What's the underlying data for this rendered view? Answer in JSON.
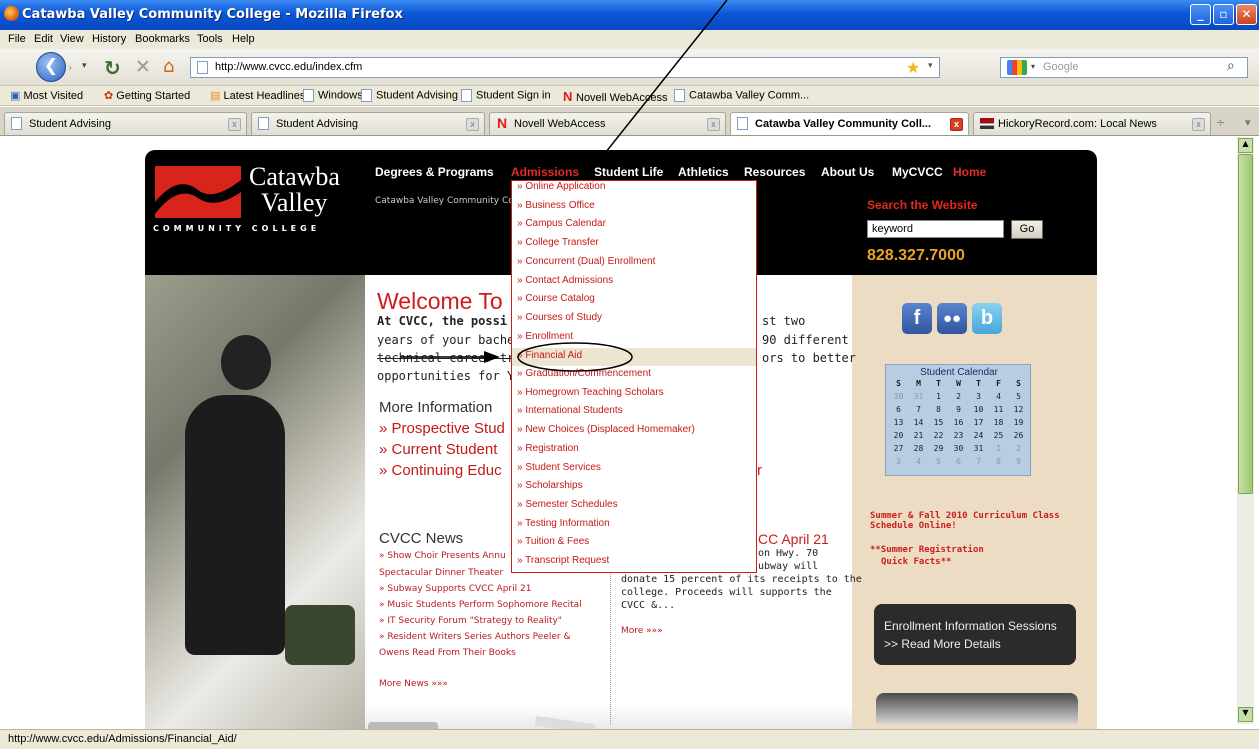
{
  "window": {
    "title": "Catawba Valley Community College - Mozilla Firefox"
  },
  "menu": [
    "File",
    "Edit",
    "View",
    "History",
    "Bookmarks",
    "Tools",
    "Help"
  ],
  "toolbar": {
    "url": "http://www.cvcc.edu/index.cfm",
    "search_placeholder": "Google"
  },
  "bookmarks": [
    "Most Visited",
    "Getting Started",
    "Latest Headlines",
    "Windows",
    "Student Advising",
    "Student Sign in",
    "Novell WebAccess",
    "Catawba Valley Comm..."
  ],
  "tabs": [
    "Student Advising",
    "Student Advising",
    "Novell WebAccess",
    "Catawba Valley Community Coll...",
    "HickoryRecord.com: Local News"
  ],
  "site": {
    "logo": {
      "line1": "Catawba",
      "line2": "Valley",
      "line3": "COMMUNITY COLLEGE"
    },
    "nav": [
      "Degrees & Programs",
      "Admissions",
      "Student Life",
      "Athletics",
      "Resources",
      "About Us",
      "MyCVCC",
      "Home"
    ],
    "tagline": "Catawba Valley Community Colle",
    "search_label": "Search the Website",
    "search_value": "keyword",
    "go": "Go",
    "phone": "828.327.7000",
    "welcome": "Welcome To",
    "intro": [
      "At CVCC, the possi",
      "years of your bachel",
      "technical career trai",
      "opportunities for YO"
    ],
    "intro_right": [
      "st two",
      "90 different",
      "ors to better"
    ],
    "more_info": "More Information",
    "more_links": [
      "» Prospective Stud",
      "» Current Student",
      "» Continuing Educ"
    ],
    "more_links_tail": "r",
    "news_heading": "CVCC News",
    "news": [
      "» Show Choir Presents Annu",
      "Spectacular Dinner Theater",
      "» Subway Supports CVCC April 21",
      "» Music Students Perform Sophomore Recital",
      "» IT Security Forum \"Strategy to Reality\"",
      "» Resident Writers Series Authors Peeler &",
      "Owens Read From Their Books"
    ],
    "more_news": "More News »»»",
    "story_title": "CC April 21",
    "story": [
      "on Hwy. 70",
      "ubway will",
      "donate 15 percent of its receipts to the",
      "college. Proceeds will supports the",
      "CVCC &..."
    ],
    "story_more": "More »»»",
    "dropdown": [
      "» Online Application",
      "» Business Office",
      "» Campus Calendar",
      "» College Transfer",
      "» Concurrent (Dual) Enrollment",
      "» Contact Admissions",
      "» Course Catalog",
      "» Courses of Study",
      "» Enrollment",
      "» Financial Aid",
      "» Graduation/Commencement",
      "» Homegrown Teaching Scholars",
      "» International Students",
      "» New Choices (Displaced Homemaker)",
      "» Registration",
      "» Student Services",
      "» Scholarships",
      "» Semester Schedules",
      "» Testing Information",
      "» Tuition & Fees",
      "» Transcript Request"
    ],
    "social": [
      "f",
      "",
      "b"
    ],
    "calendar": {
      "title": "Student Calendar",
      "days": [
        "S",
        "M",
        "T",
        "W",
        "T",
        "F",
        "S"
      ],
      "weeks": [
        [
          "30",
          "31",
          "1",
          "2",
          "3",
          "4",
          "5"
        ],
        [
          "6",
          "7",
          "8",
          "9",
          "10",
          "11",
          "12"
        ],
        [
          "13",
          "14",
          "15",
          "16",
          "17",
          "18",
          "19"
        ],
        [
          "20",
          "21",
          "22",
          "23",
          "24",
          "25",
          "26"
        ],
        [
          "27",
          "28",
          "29",
          "30",
          "31",
          "1",
          "2"
        ],
        [
          "3",
          "4",
          "5",
          "6",
          "7",
          "8",
          "9"
        ]
      ]
    },
    "summer": "Summer & Fall 2010 Curriculum Class Schedule Online!",
    "summer_reg": [
      "**Summer Registration",
      "Quick Facts**"
    ],
    "enroll": [
      "Enrollment Information Sessions",
      ">> Read More Details"
    ]
  },
  "status": "http://www.cvcc.edu/Admissions/Financial_Aid/",
  "colors": {
    "accent": "#d21a1a",
    "titlebar": "#0a57d8"
  }
}
